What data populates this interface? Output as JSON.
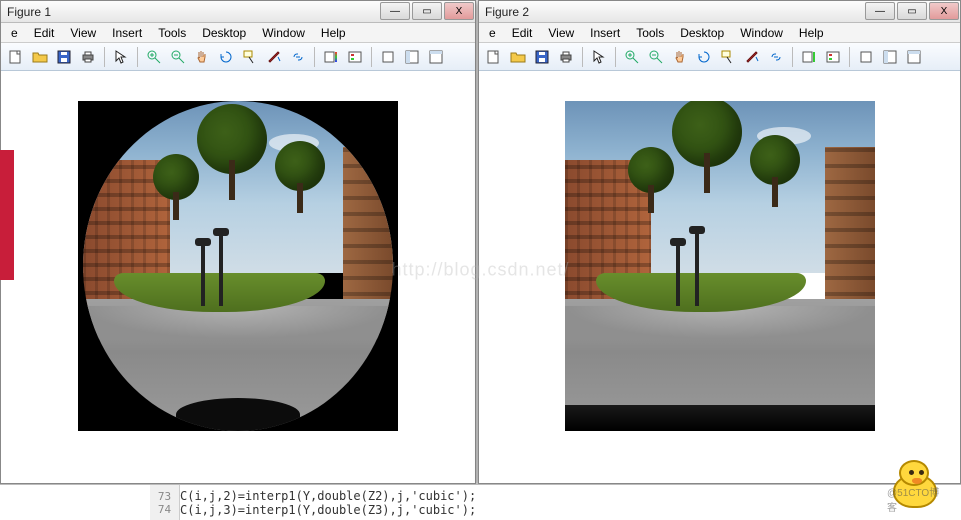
{
  "windows": [
    {
      "title": "Figure 1"
    },
    {
      "title": "Figure 2"
    }
  ],
  "menu": {
    "items": [
      "e",
      "Edit",
      "View",
      "Insert",
      "Tools",
      "Desktop",
      "Window",
      "Help"
    ]
  },
  "win_controls": {
    "min": "—",
    "max": "▭",
    "close": "X"
  },
  "toolbar_icons": [
    "new-figure",
    "open",
    "save",
    "print",
    "arrow",
    "zoom-in",
    "zoom-out",
    "pan",
    "rotate",
    "data-cursor",
    "brush",
    "link",
    "insert-colorbar",
    "insert-legend",
    "hide-plot-tools",
    "dock",
    "undock"
  ],
  "watermark": "http://blog.csdn.net/",
  "code": {
    "line_numbers": [
      "73",
      "74"
    ],
    "lines": [
      "C(i,j,2)=interp1(Y,double(Z2),j,'cubic');",
      "C(i,j,3)=interp1(Y,double(Z3),j,'cubic');"
    ]
  },
  "mascot_label": "@51CTO博客"
}
